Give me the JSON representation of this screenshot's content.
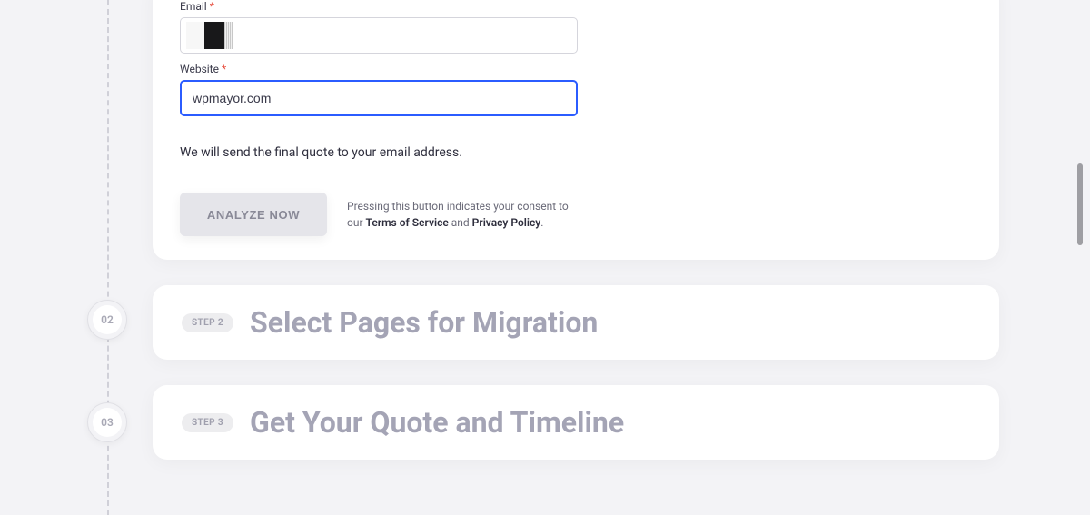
{
  "form": {
    "email_label": "Email",
    "website_label": "Website",
    "website_value": "wpmayor.com",
    "helper_text": "We will send the final quote to your email address.",
    "analyze_button": "ANALYZE NOW",
    "consent_prefix": "Pressing this button indicates your consent to our ",
    "tos_text": "Terms of Service",
    "consent_middle": " and ",
    "privacy_text": "Privacy Policy",
    "consent_suffix": "."
  },
  "steps": {
    "marker2": "02",
    "marker3": "03",
    "badge2": "STEP 2",
    "title2": "Select Pages for Migration",
    "badge3": "STEP 3",
    "title3": "Get Your Quote and Timeline"
  }
}
